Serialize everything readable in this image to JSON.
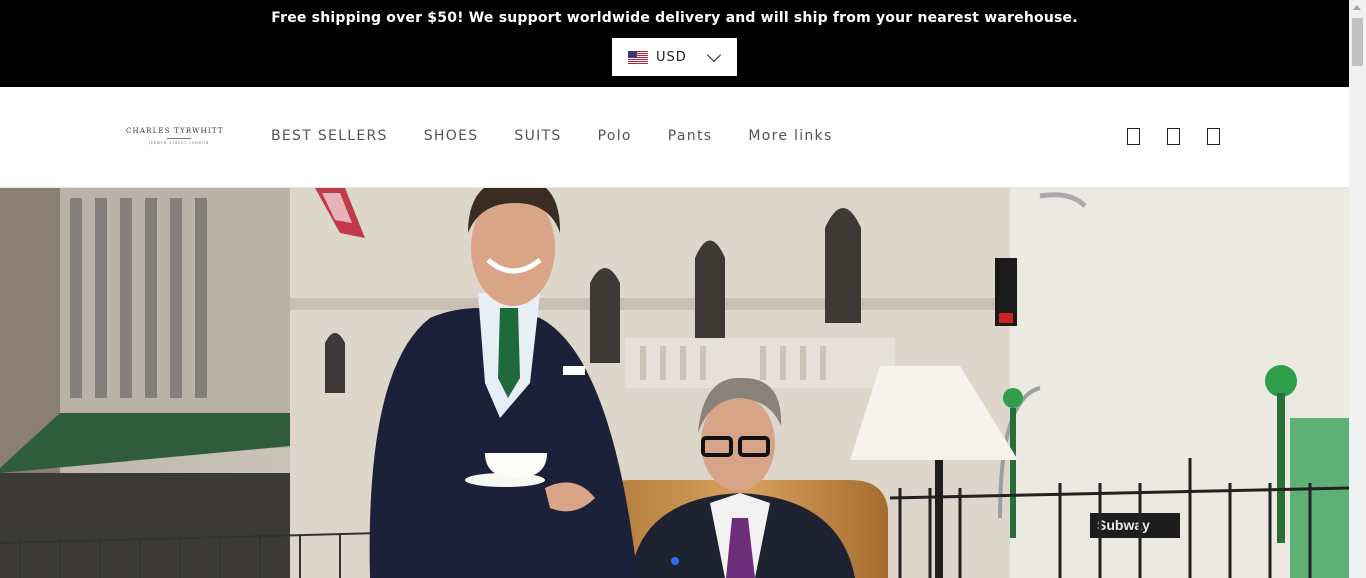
{
  "announcement": {
    "text": "Free shipping over $50! We support worldwide delivery and will ship from your nearest warehouse.",
    "currency": "USD"
  },
  "logo": {
    "name": "CHARLES TYRWHITT",
    "sub": "JERMYN STREET LONDON"
  },
  "nav": {
    "items": [
      "BEST SELLERS",
      "SHOES",
      "SUITS",
      "Polo",
      "Pants",
      "More links"
    ]
  },
  "icons": [
    "search-icon",
    "account-icon",
    "cart-icon"
  ],
  "hero": {
    "subway_sign": "Subway"
  },
  "colors": {
    "announce_bg": "#000000",
    "nav_text": "#555555",
    "slider_dot": "#2d6ff0"
  }
}
